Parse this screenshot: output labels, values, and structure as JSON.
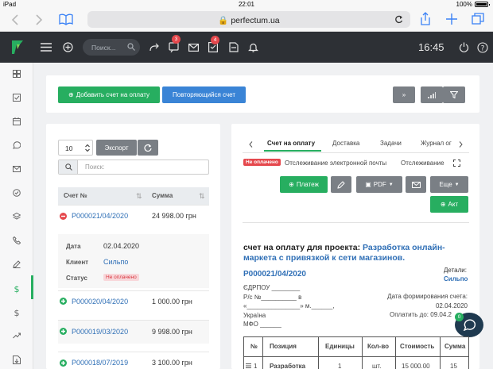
{
  "ios": {
    "device": "iPad",
    "time": "22:01",
    "battery": "100%"
  },
  "browser": {
    "url": "perfectum.ua"
  },
  "topbar": {
    "search_placeholder": "Поиск...",
    "tasks_badge": "3",
    "doc_badge": "4",
    "clock": "16:45"
  },
  "toolbar": {
    "add_invoice": "Добавить счет на оплату",
    "recurring": "Повторяющийся счет",
    "expand": "»"
  },
  "list": {
    "page_size": "10",
    "export": "Экспорт",
    "search_placeholder": "Поиск:",
    "col_number": "Счет №",
    "col_sum": "Сумма",
    "rows": [
      {
        "number": "P000021/04/2020",
        "sum": "24 998.00 грн"
      },
      {
        "number": "P000020/04/2020",
        "sum": "1 000.00 грн"
      },
      {
        "number": "P000019/03/2020",
        "sum": "9 998.00 грн"
      },
      {
        "number": "P000018/07/2019",
        "sum": "3 100.00 грн"
      }
    ],
    "details": {
      "date_label": "Дата",
      "date_value": "02.04.2020",
      "client_label": "Клиент",
      "client_value": "Сильпо",
      "status_label": "Статус",
      "status_value": "Не оплачено"
    }
  },
  "detail": {
    "tabs": [
      "Счет на оплату",
      "Доставка",
      "Задачи",
      "Журнал ог"
    ],
    "status_badge": "Не оплачено",
    "tracking_email": "Отслеживание электронной почты",
    "tracking": "Отслеживание",
    "actions": {
      "payment": "Платеж",
      "pdf": "PDF",
      "more": "Еще",
      "act": "Акт"
    },
    "heading_prefix": "счет на оплату для проекта:",
    "heading_line1": "Разработка онлайн-",
    "heading_line2": "маркета с привязкой к сети магазинов.",
    "invoice_number": "P000021/04/2020",
    "details_label": "Детали:",
    "details_client": "Сильпо",
    "req_line1": "ЄДРПОУ ________",
    "req_line2": "Р/с №__________ в",
    "req_line3": "«_______________» м.______,",
    "req_line4": "Україна",
    "req_line5": "МФО ______",
    "date_label": "Дата формирования счета:",
    "date_value": "02.04.2020",
    "due_label": "Оплатить до: 09.04.2",
    "chat_badge": "0",
    "table_headers": [
      "№",
      "Позиция",
      "Единицы",
      "Кол-во",
      "Стоимость",
      "Сумма"
    ],
    "table_row": [
      "1",
      "Разработка",
      "1",
      "шт.",
      "15 000.00",
      "15"
    ]
  }
}
